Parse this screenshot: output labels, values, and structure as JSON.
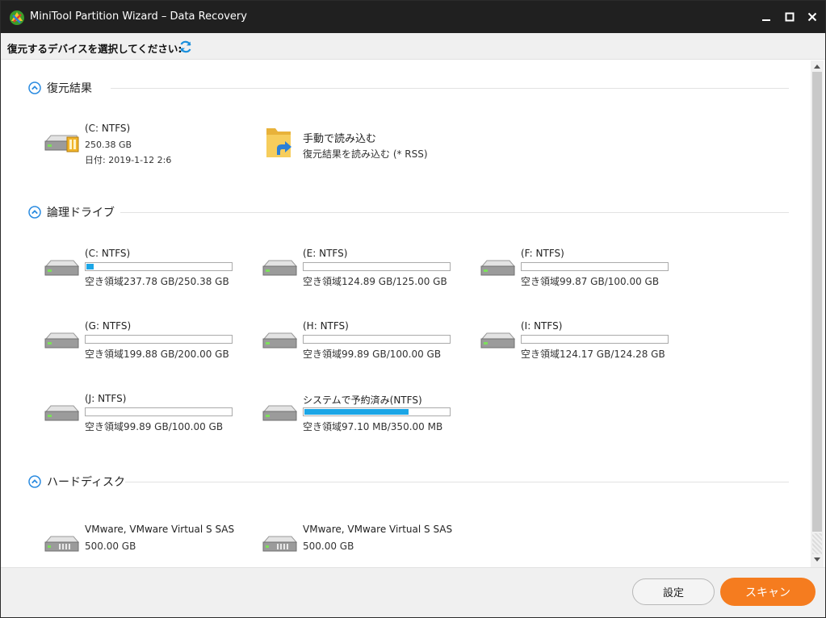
{
  "window": {
    "title": "MiniTool Partition Wizard – Data Recovery"
  },
  "subheader": {
    "label": "復元するデバイスを選択してください:"
  },
  "sections": {
    "recovery": {
      "title": "復元結果",
      "item": {
        "label": "(C: NTFS)",
        "size": "250.38 GB",
        "date": "日付: 2019-1-12 2:6"
      },
      "load": {
        "label": "手動で読み込む",
        "sub": "復元結果を読み込む (* RSS)"
      }
    },
    "logical": {
      "title": "論理ドライブ",
      "drives": [
        {
          "label": "(C: NTFS)",
          "free": "空き領域237.78 GB/250.38 GB",
          "used_fraction": 0.05
        },
        {
          "label": "(E: NTFS)",
          "free": "空き領域124.89 GB/125.00 GB",
          "used_fraction": 0.0
        },
        {
          "label": "(F: NTFS)",
          "free": "空き領域99.87 GB/100.00 GB",
          "used_fraction": 0.0
        },
        {
          "label": "(G: NTFS)",
          "free": "空き領域199.88 GB/200.00 GB",
          "used_fraction": 0.0
        },
        {
          "label": "(H: NTFS)",
          "free": "空き領域99.89 GB/100.00 GB",
          "used_fraction": 0.0
        },
        {
          "label": "(I: NTFS)",
          "free": "空き領域124.17 GB/124.28 GB",
          "used_fraction": 0.0
        },
        {
          "label": "(J: NTFS)",
          "free": "空き領域99.89 GB/100.00 GB",
          "used_fraction": 0.0
        },
        {
          "label": "システムで予約済み(NTFS)",
          "free": "空き領域97.10 MB/350.00 MB",
          "used_fraction": 0.72
        }
      ]
    },
    "disks": {
      "title": "ハードディスク",
      "items": [
        {
          "label": "VMware, VMware Virtual S SAS",
          "capacity": "500.00 GB"
        },
        {
          "label": "VMware, VMware Virtual S SAS",
          "capacity": "500.00 GB"
        }
      ]
    }
  },
  "footer": {
    "settings_label": "設定",
    "scan_label": "スキャン"
  },
  "colors": {
    "accent": "#f57c1f",
    "usage_bar": "#1ba6e6",
    "titlebar": "#202020",
    "toggle_blue": "#2a8be0"
  }
}
